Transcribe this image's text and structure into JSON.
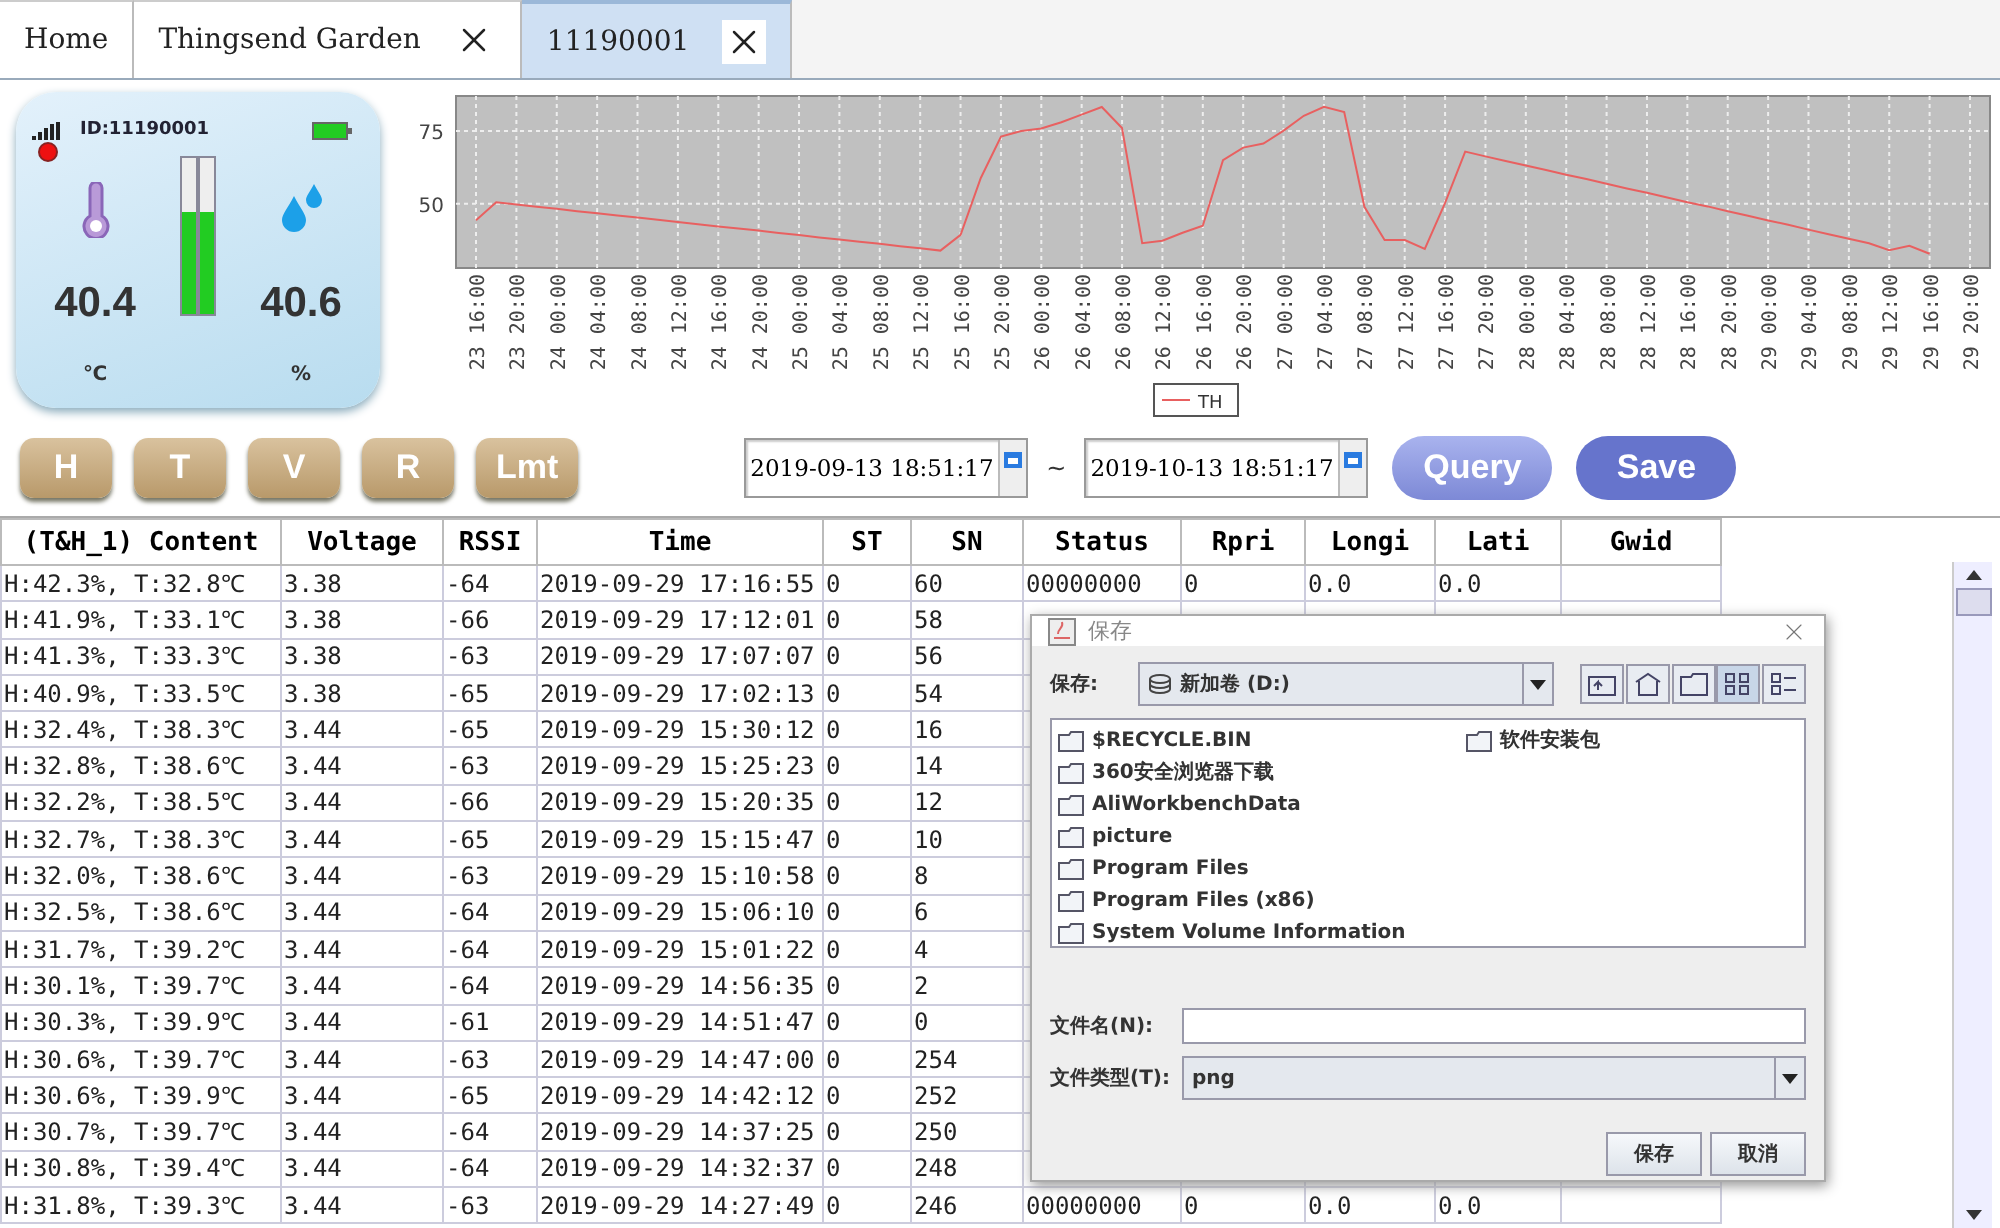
{
  "tabs": [
    {
      "label": "Home",
      "closable": false,
      "selected": false
    },
    {
      "label": "Thingsend Garden",
      "closable": true,
      "selected": false
    },
    {
      "label": "11190001",
      "closable": true,
      "selected": true
    }
  ],
  "device": {
    "id": "ID:11190001",
    "temperature": {
      "value": "40.4",
      "unit": "℃"
    },
    "humidity": {
      "value": "40.6",
      "unit": "%"
    },
    "gauge": {
      "level": 0.66
    }
  },
  "chart": {
    "chart_data": {
      "type": "line",
      "grid": true,
      "ylim": [
        28,
        87
      ],
      "yticks": [
        50,
        75
      ],
      "categories": [
        "23 16:00",
        null,
        "23 20:00",
        null,
        "24 00:00",
        null,
        "24 04:00",
        null,
        "24 08:00",
        null,
        "24 12:00",
        null,
        "24 16:00",
        null,
        "24 20:00",
        null,
        "25 00:00",
        null,
        "25 04:00",
        null,
        "25 08:00",
        null,
        "25 12:00",
        null,
        "25 16:00",
        null,
        "25 20:00",
        null,
        "26 00:00",
        null,
        "26 04:00",
        null,
        "26 08:00",
        null,
        "26 12:00",
        null,
        "26 16:00",
        null,
        "26 20:00",
        null,
        "27 00:00",
        null,
        "27 04:00",
        null,
        "27 08:00",
        null,
        "27 12:00",
        null,
        "27 16:00",
        null,
        "27 20:00",
        null,
        "28 00:00",
        null,
        "28 04:00",
        null,
        "28 08:00",
        null,
        "28 12:00",
        null,
        "28 16:00",
        null,
        "28 20:00",
        null,
        "29 00:00",
        null,
        "29 04:00",
        null,
        "29 08:00",
        null,
        "29 12:00",
        null,
        "29 16:00",
        null,
        "29 20:00"
      ],
      "series": [
        {
          "name": "TH",
          "color": "#e86060",
          "values": [
            44.4,
            50.6,
            49.8,
            49.0,
            48.3,
            47.5,
            46.8,
            46.0,
            45.3,
            44.5,
            43.8,
            43.0,
            42.3,
            41.5,
            40.8,
            40.0,
            39.3,
            38.5,
            37.8,
            37.0,
            36.3,
            35.5,
            34.8,
            34.0,
            39.4,
            58.9,
            73.1,
            75.0,
            75.9,
            78.0,
            80.6,
            83.2,
            76.0,
            36.5,
            37.3,
            40.1,
            42.5,
            65.0,
            69.3,
            70.7,
            75.1,
            80.2,
            83.3,
            81.5,
            49.0,
            37.6,
            37.6,
            34.5,
            50.2,
            67.9,
            66.3,
            64.7,
            63.2,
            61.6,
            60.0,
            58.5,
            56.9,
            55.3,
            53.8,
            52.2,
            50.6,
            49.1,
            47.5,
            45.9,
            44.3,
            42.8,
            41.2,
            39.6,
            38.0,
            36.5,
            34.1,
            35.6,
            32.9,
            null,
            null
          ]
        }
      ]
    }
  },
  "filter_buttons": [
    "H",
    "T",
    "V",
    "R",
    "Lmt"
  ],
  "date_from": "2019-09-13 18:51:17",
  "range_separator": "~",
  "date_to": "2019-10-13 18:51:17",
  "actions": [
    {
      "label": "Query",
      "kind": "secondary"
    },
    {
      "label": "Save",
      "kind": "primary"
    }
  ],
  "table": {
    "columns": [
      "(T&H_1) Content",
      "Voltage",
      "RSSI",
      "Time",
      "ST",
      "SN",
      "Status",
      "Rpri",
      "Longi",
      "Lati",
      "Gwid"
    ],
    "rows": [
      [
        "H:42.3%, T:32.8℃",
        "3.38",
        "-64",
        "2019-09-29 17:16:55",
        "0",
        "60",
        "00000000",
        "0",
        "0.0",
        "0.0"
      ],
      [
        "H:41.9%, T:33.1℃",
        "3.38",
        "-66",
        "2019-09-29 17:12:01",
        "0",
        "58"
      ],
      [
        "H:41.3%, T:33.3℃",
        "3.38",
        "-63",
        "2019-09-29 17:07:07",
        "0",
        "56"
      ],
      [
        "H:40.9%, T:33.5℃",
        "3.38",
        "-65",
        "2019-09-29 17:02:13",
        "0",
        "54"
      ],
      [
        "H:32.4%, T:38.3℃",
        "3.44",
        "-65",
        "2019-09-29 15:30:12",
        "0",
        "16"
      ],
      [
        "H:32.8%, T:38.6℃",
        "3.44",
        "-63",
        "2019-09-29 15:25:23",
        "0",
        "14"
      ],
      [
        "H:32.2%, T:38.5℃",
        "3.44",
        "-66",
        "2019-09-29 15:20:35",
        "0",
        "12"
      ],
      [
        "H:32.7%, T:38.3℃",
        "3.44",
        "-65",
        "2019-09-29 15:15:47",
        "0",
        "10"
      ],
      [
        "H:32.0%, T:38.6℃",
        "3.44",
        "-63",
        "2019-09-29 15:10:58",
        "0",
        "8"
      ],
      [
        "H:32.5%, T:38.6℃",
        "3.44",
        "-64",
        "2019-09-29 15:06:10",
        "0",
        "6"
      ],
      [
        "H:31.7%, T:39.2℃",
        "3.44",
        "-64",
        "2019-09-29 15:01:22",
        "0",
        "4"
      ],
      [
        "H:30.1%, T:39.7℃",
        "3.44",
        "-64",
        "2019-09-29 14:56:35",
        "0",
        "2"
      ],
      [
        "H:30.3%, T:39.9℃",
        "3.44",
        "-61",
        "2019-09-29 14:51:47",
        "0",
        "0"
      ],
      [
        "H:30.6%, T:39.7℃",
        "3.44",
        "-63",
        "2019-09-29 14:47:00",
        "0",
        "254"
      ],
      [
        "H:30.6%, T:39.9℃",
        "3.44",
        "-65",
        "2019-09-29 14:42:12",
        "0",
        "252"
      ],
      [
        "H:30.7%, T:39.7℃",
        "3.44",
        "-64",
        "2019-09-29 14:37:25",
        "0",
        "250"
      ],
      [
        "H:30.8%, T:39.4℃",
        "3.44",
        "-64",
        "2019-09-29 14:32:37",
        "0",
        "248"
      ],
      [
        "H:31.8%, T:39.3℃",
        "3.44",
        "-63",
        "2019-09-29 14:27:49",
        "0",
        "246",
        "00000000",
        "0",
        "0.0",
        "0.0"
      ]
    ]
  },
  "save_dialog": {
    "title": "保存",
    "location_label": "保存:",
    "location": "新加卷 (D:)",
    "tools": [
      {
        "kind": "up",
        "selected": false
      },
      {
        "kind": "home",
        "selected": false
      },
      {
        "kind": "new-folder",
        "selected": false
      },
      {
        "kind": "list",
        "selected": true
      },
      {
        "kind": "details",
        "selected": false
      }
    ],
    "files": [
      "$RECYCLE.BIN",
      "360安全浏览器下载",
      "AliWorkbenchData",
      "picture",
      "Program Files",
      "Program Files (x86)",
      "System Volume Information",
      "软件安装包"
    ],
    "filename_label": "文件名(N):",
    "filetype_label": "文件类型(T):",
    "filetype": "png",
    "buttons": [
      "保存",
      "取消"
    ]
  }
}
